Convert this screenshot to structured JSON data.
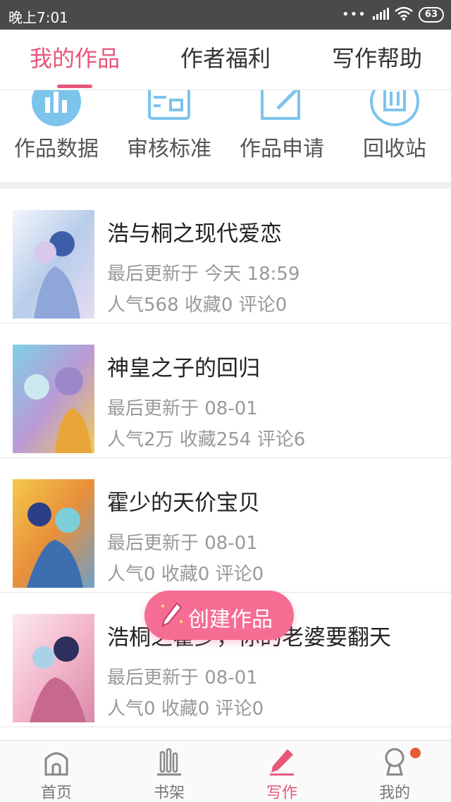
{
  "status_bar": {
    "time": "晚上7:01",
    "battery": "63"
  },
  "tabs": [
    {
      "label": "我的作品",
      "active": true
    },
    {
      "label": "作者福利",
      "active": false
    },
    {
      "label": "写作帮助",
      "active": false
    }
  ],
  "tools": [
    {
      "label": "作品数据",
      "icon": "chart-icon"
    },
    {
      "label": "审核标准",
      "icon": "review-icon"
    },
    {
      "label": "作品申请",
      "icon": "edit-icon"
    },
    {
      "label": "回收站",
      "icon": "trash-icon"
    }
  ],
  "works": [
    {
      "title": "浩与桐之现代爱恋",
      "updated": "最后更新于 今天 18:59",
      "stats": "人气568 收藏0 评论0"
    },
    {
      "title": "神皇之子的回归",
      "updated": "最后更新于 08-01",
      "stats": "人气2万 收藏254 评论6"
    },
    {
      "title": "霍少的天价宝贝",
      "updated": "最后更新于 08-01",
      "stats": "人气0 收藏0 评论0"
    },
    {
      "title": "浩桐之霍少，你的老婆要翻天",
      "updated": "最后更新于 08-01",
      "stats": "人气0 收藏0 评论0"
    }
  ],
  "fab": {
    "label": "创建作品"
  },
  "bottom_nav": [
    {
      "label": "首页",
      "icon": "home-icon",
      "active": false
    },
    {
      "label": "书架",
      "icon": "bookshelf-icon",
      "active": false
    },
    {
      "label": "写作",
      "icon": "pen-icon",
      "active": true
    },
    {
      "label": "我的",
      "icon": "profile-icon",
      "active": false
    }
  ],
  "colors": {
    "accent": "#e8567a",
    "fab": "#f56d93",
    "icon_blue": "#7cc4ec",
    "status_bar": "#4a4a4a",
    "notification": "#e95a36"
  }
}
